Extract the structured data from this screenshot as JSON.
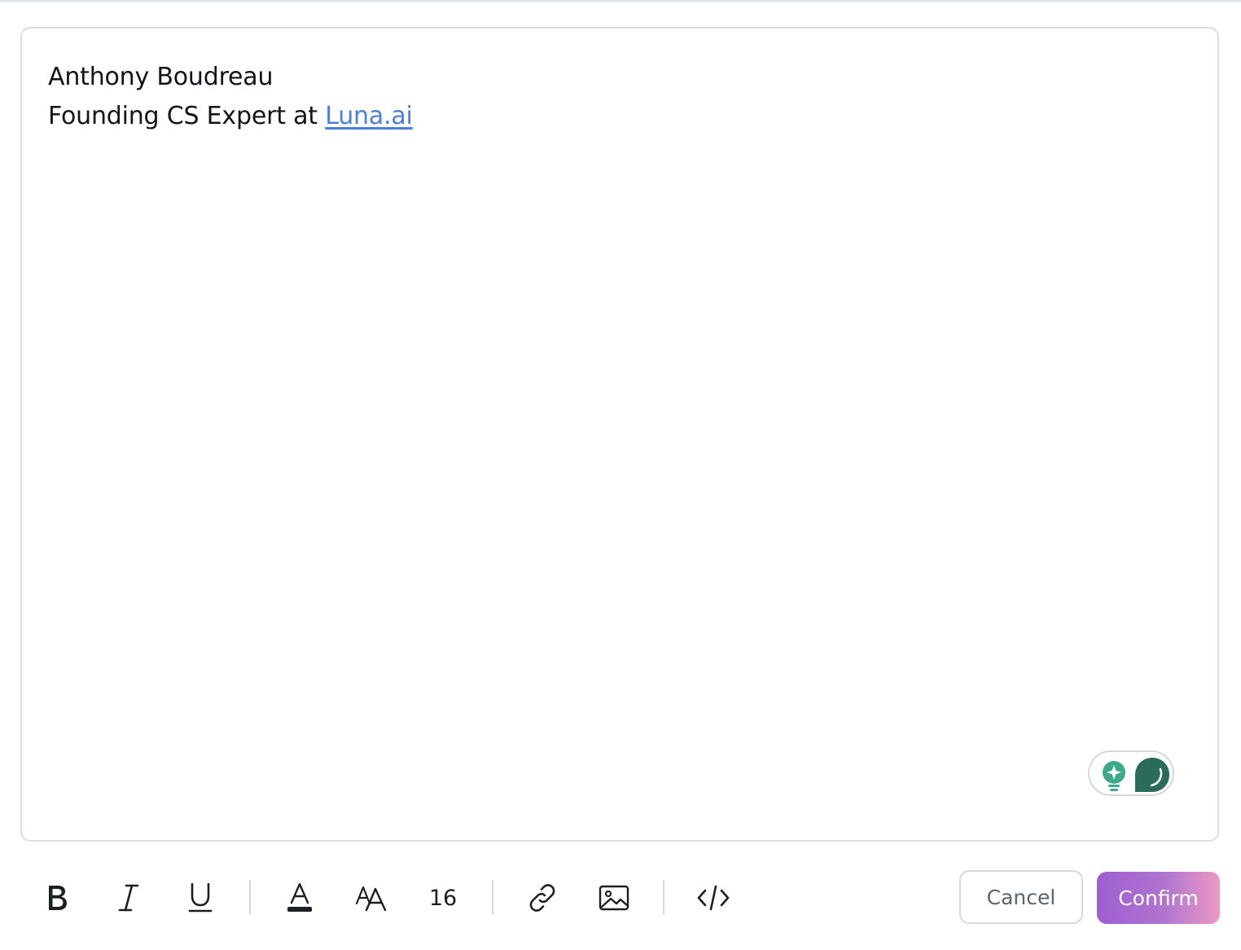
{
  "editor": {
    "line1": "Anthony Boudreau",
    "line2_prefix": "Founding CS Expert at ",
    "line2_link": "Luna.ai"
  },
  "assistant": {
    "bulb_icon": "lightbulb-sparkle-icon",
    "chat_icon": "chat-bubble-icon",
    "accent_light": "#3ea88a",
    "accent_dark": "#2b6b5c"
  },
  "toolbar": {
    "bold_icon": "bold-icon",
    "italic_icon": "italic-icon",
    "underline_icon": "underline-icon",
    "text_color_icon": "text-color-icon",
    "font_size_icon": "font-size-icon",
    "font_size_value": "16",
    "link_icon": "link-icon",
    "image_icon": "image-icon",
    "code_icon": "code-icon",
    "cancel_label": "Cancel",
    "confirm_label": "Confirm",
    "confirm_gradient": [
      "#9d5fd0",
      "#ec9ac4"
    ]
  }
}
